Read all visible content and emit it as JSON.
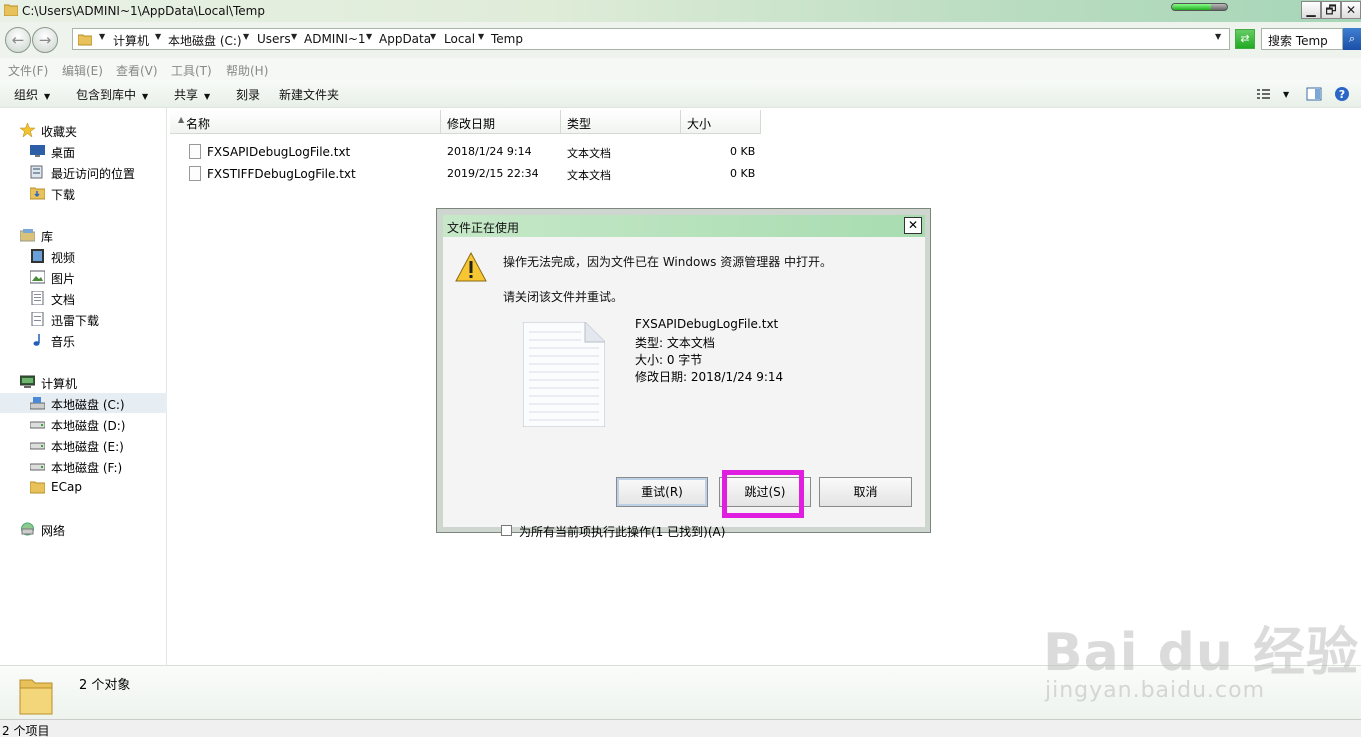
{
  "window": {
    "title": "C:\\Users\\ADMINI~1\\AppData\\Local\\Temp",
    "progress": 0.7,
    "minimize": "▁",
    "restore": "🗗",
    "close": "✕"
  },
  "address": {
    "crumbs": [
      "计算机",
      "本地磁盘 (C:)",
      "Users",
      "ADMINI~1",
      "AppData",
      "Local",
      "Temp"
    ],
    "search_placeholder": "搜索 Temp"
  },
  "menu": [
    "文件(F)",
    "编辑(E)",
    "查看(V)",
    "工具(T)",
    "帮助(H)"
  ],
  "toolbar": {
    "organize": "组织",
    "include_library": "包含到库中",
    "share": "共享",
    "burn": "刻录",
    "new_folder": "新建文件夹"
  },
  "nav": {
    "favorites": "收藏夹",
    "desktop": "桌面",
    "recent": "最近访问的位置",
    "downloads": "下载",
    "libraries": "库",
    "videos": "视频",
    "pictures": "图片",
    "documents": "文档",
    "xunlei": "迅雷下载",
    "music": "音乐",
    "computer": "计算机",
    "drive_c": "本地磁盘 (C:)",
    "drive_d": "本地磁盘 (D:)",
    "drive_e": "本地磁盘 (E:)",
    "drive_f": "本地磁盘 (F:)",
    "ecap": "ECap",
    "network": "网络"
  },
  "columns": {
    "name": "名称",
    "modified": "修改日期",
    "type": "类型",
    "size": "大小"
  },
  "files": [
    {
      "name": "FXSAPIDebugLogFile.txt",
      "modified": "2018/1/24 9:14",
      "type": "文本文档",
      "size": "0 KB"
    },
    {
      "name": "FXSTIFFDebugLogFile.txt",
      "modified": "2019/2/15 22:34",
      "type": "文本文档",
      "size": "0 KB"
    }
  ],
  "dialog": {
    "title": "文件正在使用",
    "close": "✕",
    "message": "操作无法完成，因为文件已在 Windows 资源管理器 中打开。",
    "hint": "请关闭该文件并重试。",
    "file_name": "FXSAPIDebugLogFile.txt",
    "file_type": "类型: 文本文档",
    "file_size": "大小: 0 字节",
    "file_modified": "修改日期: 2018/1/24 9:14",
    "retry": "重试(R)",
    "skip": "跳过(S)",
    "cancel": "取消",
    "apply_all": "为所有当前项执行此操作(1 已找到)(A)"
  },
  "details": {
    "count": "2 个对象"
  },
  "status": {
    "items": "2 个项目"
  },
  "watermark": {
    "brand": "Bai du 经验",
    "url": "jingyan.baidu.com"
  },
  "colors": {
    "highlight": "#e01ee0",
    "title_gradient": "#a6d5b7"
  }
}
